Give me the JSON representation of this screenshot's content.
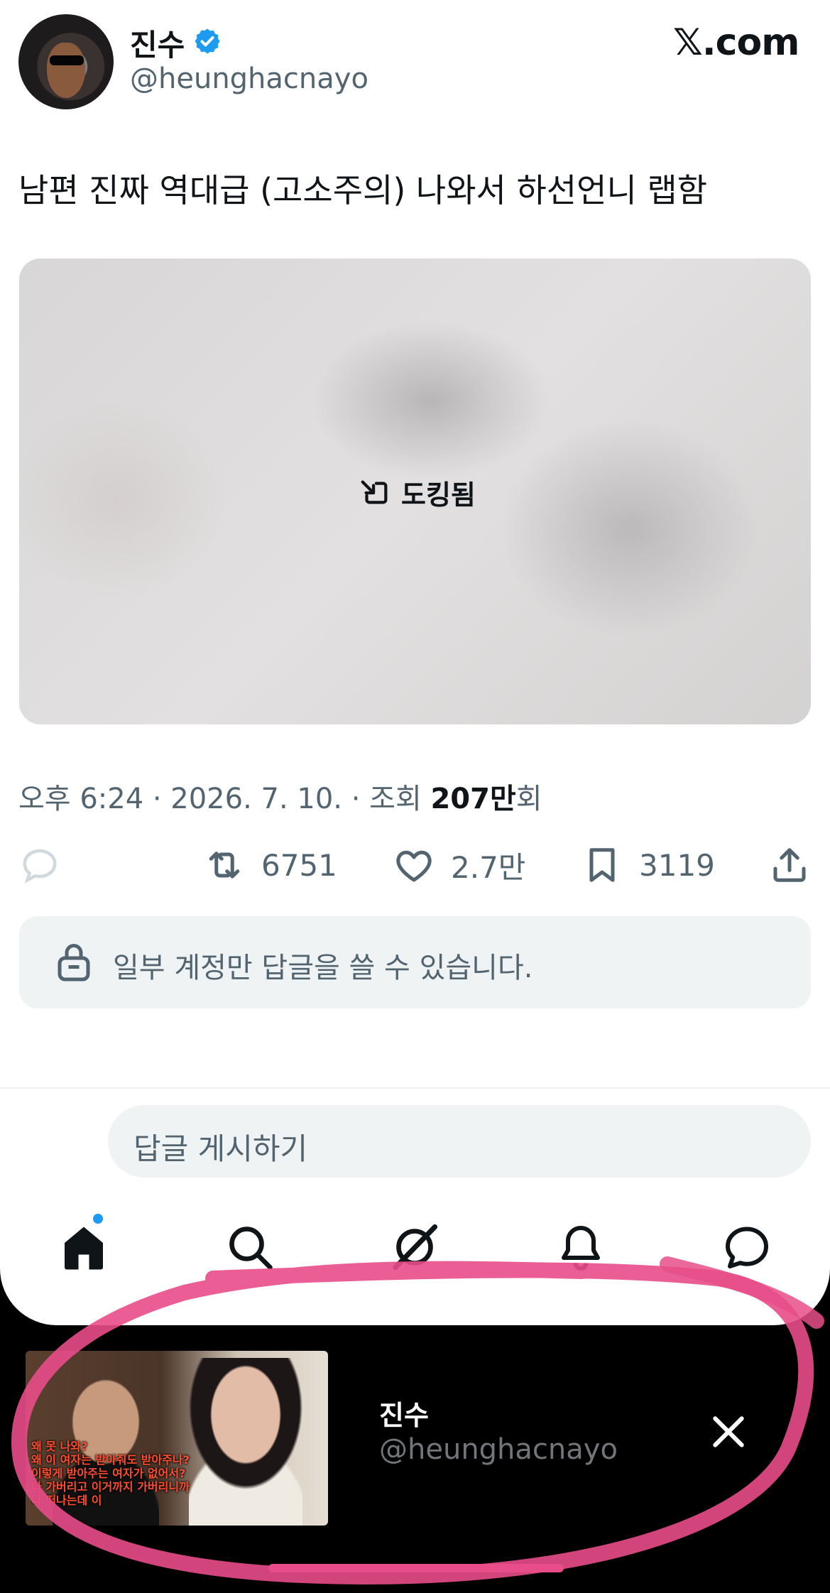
{
  "header": {
    "display_name": "진수",
    "handle": "@heunghacnayo",
    "site": "𝕏.com"
  },
  "tweet": {
    "text": "남편 진짜 역대급 (고소주의) 나와서 하선언니 랩함",
    "media_status": "도킹됨",
    "meta_prefix": "오후 6:24 · 2026. 7. 10. · 조회 ",
    "views_bold": "207만",
    "views_suffix": "회"
  },
  "actions": {
    "retweets": "6751",
    "likes": "2.7만",
    "bookmarks": "3119"
  },
  "reply_restriction": "일부 계정만 답글을 쓸 수 있습니다.",
  "reply_placeholder": "답글 게시하기",
  "mini_player": {
    "name": "진수",
    "handle": "@heunghacnayo",
    "subtitles": [
      "왜 못 나와?",
      "왜 이 여자는 받아줘도 받아주나?",
      "이렇게 받아주는 여자가 없어서?",
      "다 가버리고 이거까지 가버리니까",
      "다 떠나는데 이"
    ]
  },
  "colors": {
    "accent": "#1d9bf0",
    "scribble": "#e84d8a"
  }
}
